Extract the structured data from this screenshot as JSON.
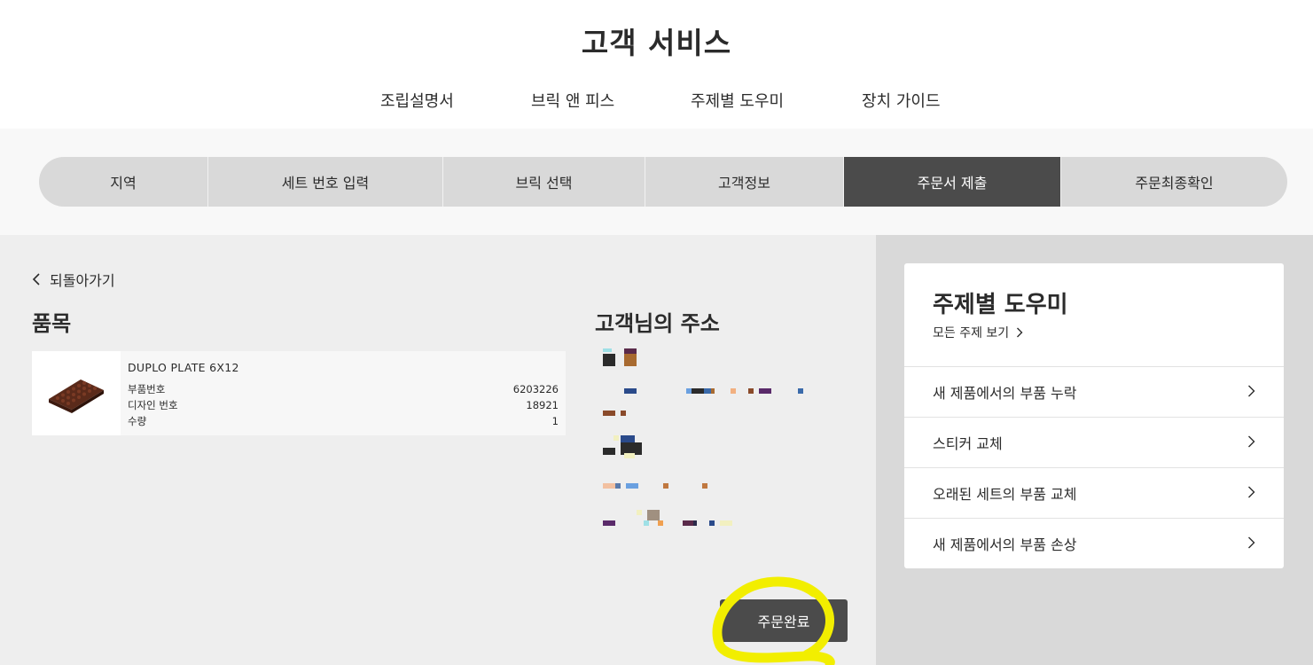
{
  "header": {
    "title": "고객 서비스",
    "nav": [
      "조립설명서",
      "브릭 앤 피스",
      "주제별 도우미",
      "장치 가이드"
    ]
  },
  "stepper": {
    "steps": [
      "지역",
      "세트 번호 입력",
      "브릭 선택",
      "고객정보",
      "주문서 제출",
      "주문최종확인"
    ],
    "active_index": 4
  },
  "main": {
    "back_label": "되돌아가기",
    "items_title": "품목",
    "item": {
      "name": "DUPLO PLATE 6X12",
      "rows": [
        {
          "label": "부품번호",
          "value": "6203226"
        },
        {
          "label": "디자인 번호",
          "value": "18921"
        },
        {
          "label": "수량",
          "value": "1"
        }
      ]
    },
    "address_title": "고객님의 주소",
    "submit_label": "주문완료"
  },
  "aside": {
    "title": "주제별 도우미",
    "all_topics_label": "모든 주제 보기",
    "topics": [
      "새 제품에서의 부품 누락",
      "스티커 교체",
      "오래된 세트의 부품 교체",
      "새 제품에서의 부품 손상"
    ]
  },
  "colors": {
    "active_step": "#4b4b4b",
    "stepper_bg": "#d9d9d9",
    "main_bg": "#eeeeee",
    "aside_bg": "#d9d9d9",
    "button": "#4b4b4b",
    "highlight": "#f2ee00"
  }
}
